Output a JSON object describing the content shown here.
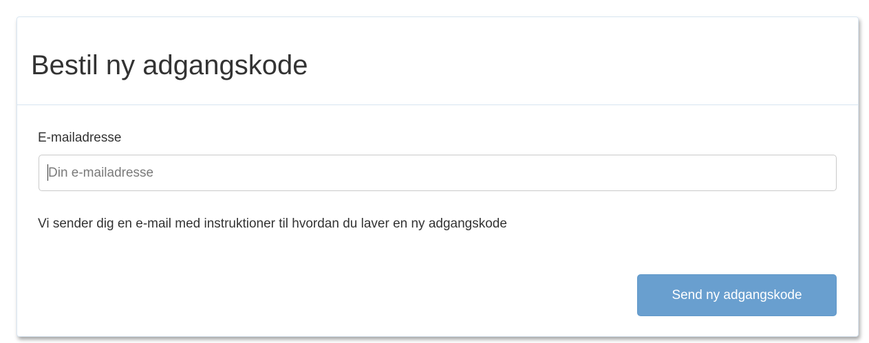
{
  "panel": {
    "title": "Bestil ny adgangskode"
  },
  "form": {
    "email_label": "E-mailadresse",
    "email_value": "",
    "email_placeholder": "Din e-mailadresse",
    "help_text": "Vi sender dig en e-mail med instruktioner til hvordan du laver en ny adgangskode",
    "submit_label": "Send ny adgangskode"
  },
  "colors": {
    "button_bg": "#699fcf",
    "button_text": "#ffffff",
    "text": "#333333",
    "divider": "#d6e4f0"
  }
}
